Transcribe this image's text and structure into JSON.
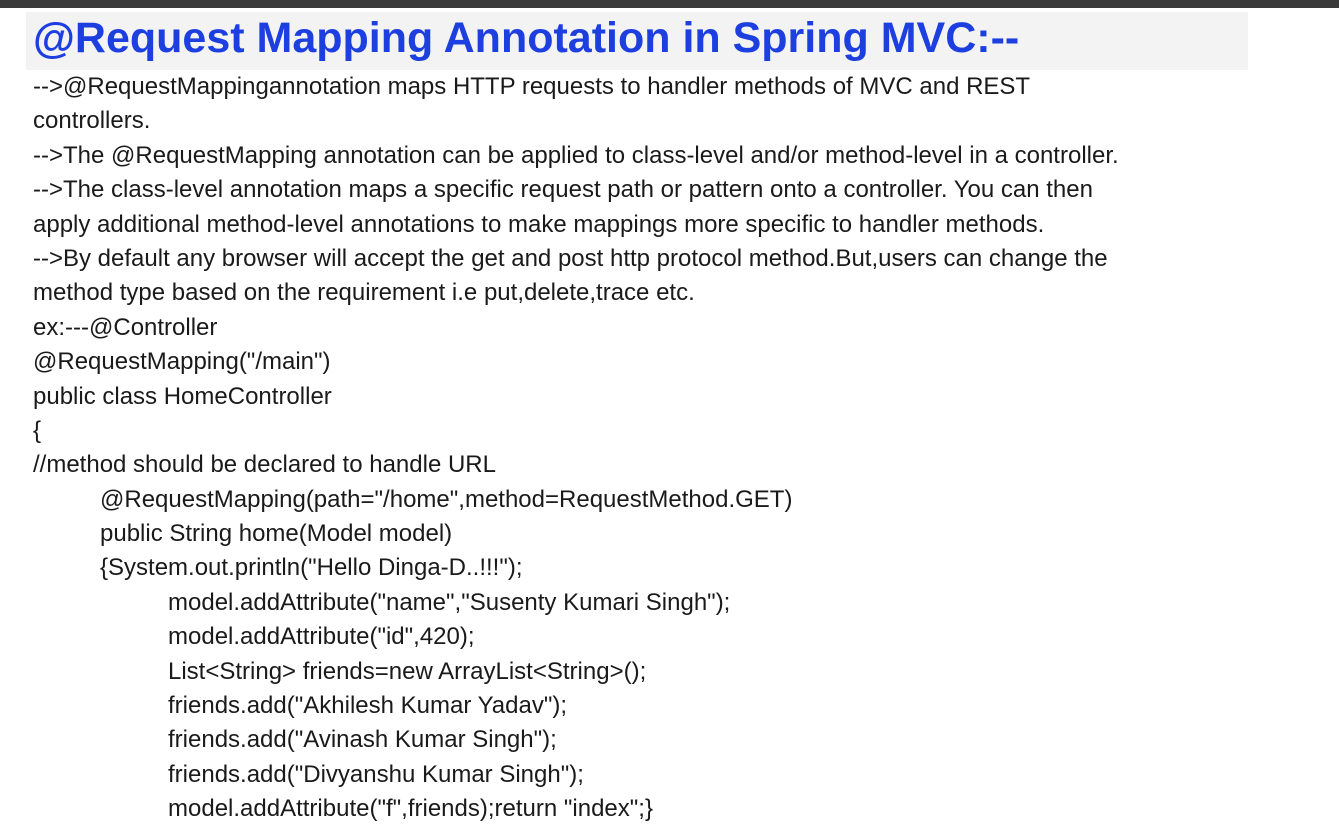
{
  "title": "@Request Mapping Annotation in Spring MVC:--",
  "lines": [
    {
      "text": "-->@RequestMappingannotation maps HTTP requests to handler methods of MVC and REST",
      "indent": 0
    },
    {
      "text": "controllers.",
      "indent": 0
    },
    {
      "text": "-->The @RequestMapping annotation can be applied to class-level and/or method-level in a controller.",
      "indent": 0
    },
    {
      "text": "-->The class-level annotation maps a specific request path or pattern onto a controller. You can then",
      "indent": 0
    },
    {
      "text": "apply additional method-level annotations to make mappings more specific to handler methods.",
      "indent": 0
    },
    {
      "text": "-->By default any browser will accept the get and post http protocol method.But,users can change the",
      "indent": 0
    },
    {
      "text": "method type based on the requirement i.e put,delete,trace etc.",
      "indent": 0
    },
    {
      "text": "ex:---@Controller",
      "indent": 0
    },
    {
      "text": "@RequestMapping(\"/main\")",
      "indent": 0
    },
    {
      "text": "public class HomeController",
      "indent": 0
    },
    {
      "text": "{",
      "indent": 0
    },
    {
      "text": "//method should be declared to handle URL",
      "indent": 0
    },
    {
      "text": "@RequestMapping(path=\"/home\",method=RequestMethod.GET)",
      "indent": 1
    },
    {
      "text": "public String home(Model model)",
      "indent": 1
    },
    {
      "text": "{System.out.println(\"Hello Dinga-D..!!!\");",
      "indent": 1
    },
    {
      "text": "model.addAttribute(\"name\",\"Susenty Kumari Singh\");",
      "indent": 2
    },
    {
      "text": "model.addAttribute(\"id\",420);",
      "indent": 2
    },
    {
      "text": "List<String> friends=new ArrayList<String>();",
      "indent": 2
    },
    {
      "text": "friends.add(\"Akhilesh Kumar Yadav\");",
      "indent": 2
    },
    {
      "text": "friends.add(\"Avinash Kumar Singh\");",
      "indent": 2
    },
    {
      "text": "friends.add(\"Divyanshu Kumar Singh\");",
      "indent": 2
    },
    {
      "text": "model.addAttribute(\"f\",friends);return \"index\";}",
      "indent": 2
    }
  ]
}
